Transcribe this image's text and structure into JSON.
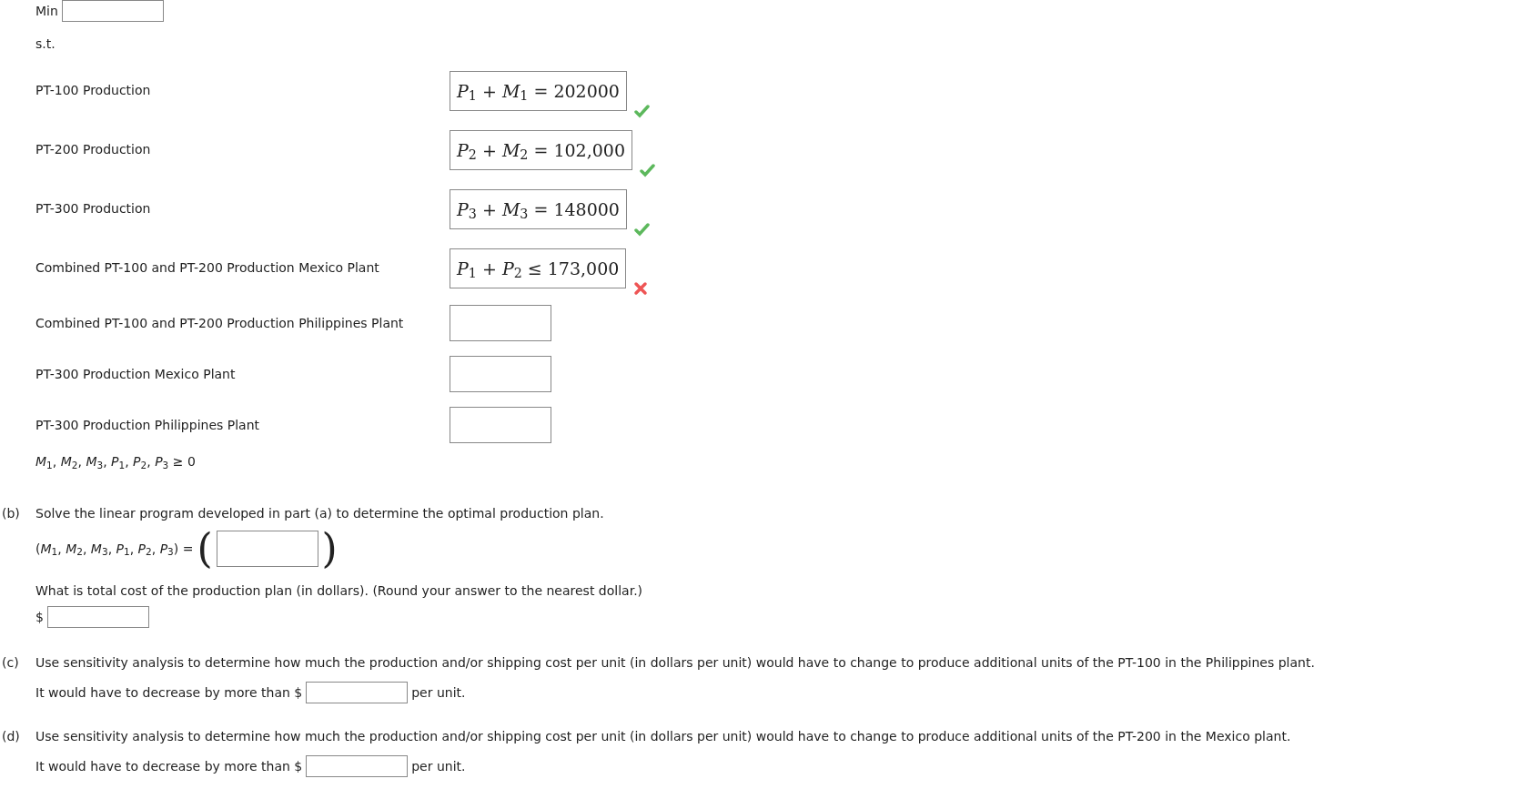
{
  "objective": {
    "label": "Min"
  },
  "st_label": "s.t.",
  "constraints": [
    {
      "label": "PT-100 Production",
      "answer": "*P*$_{1}$ + *M*$_{1}$ = 202000",
      "correct": true
    },
    {
      "label": "PT-200 Production",
      "answer": "*P*$_{2}$ + *M*$_{2}$ = 102,000",
      "correct": true
    },
    {
      "label": "PT-300 Production",
      "answer": "*P*$_{3}$ + *M*$_{3}$ = 148000",
      "correct": true
    },
    {
      "label": "Combined PT-100 and PT-200 Production Mexico Plant",
      "answer": "*P*$_{1}$ + *P*$_{2}$ ≤ 173,000",
      "correct": false
    },
    {
      "label": "Combined PT-100 and PT-200 Production Philippines Plant"
    },
    {
      "label": "PT-300 Production Mexico Plant"
    },
    {
      "label": "PT-300 Production Philippines Plant"
    }
  ],
  "nonnegativity": "*M*$_{1}$, *M*$_{2}$, *M*$_{3}$, *P*$_{1}$, *P*$_{2}$, *P*$_{3}$ ≥ 0",
  "parts": [
    {
      "letter": "(b)",
      "question": "Solve the linear program developed in part (a) to determine the optimal production plan.",
      "tuple_label": "(*M*$_{1}$, *M*$_{2}$, *M*$_{3}$, *P*$_{1}$, *P*$_{2}$, *P*$_{3}$) =",
      "tuple_open": "(",
      "tuple_close": ")",
      "followup": "What is total cost of the production plan (in dollars). (Round your answer to the nearest dollar.)",
      "prefix": "$"
    },
    {
      "letter": "(c)",
      "question": "Use sensitivity analysis to determine how much the production and/or shipping cost per unit (in dollars per unit) would have to change to produce additional units of the PT-100 in the Philippines plant.",
      "answer_before": "It would have to decrease by more than $",
      "answer_after": "per unit."
    },
    {
      "letter": "(d)",
      "question": "Use sensitivity analysis to determine how much the production and/or shipping cost per unit (in dollars per unit) would have to change to produce additional units of the PT-200 in the Mexico plant.",
      "answer_before": "It would have to decrease by more than $",
      "answer_after": "per unit."
    }
  ]
}
